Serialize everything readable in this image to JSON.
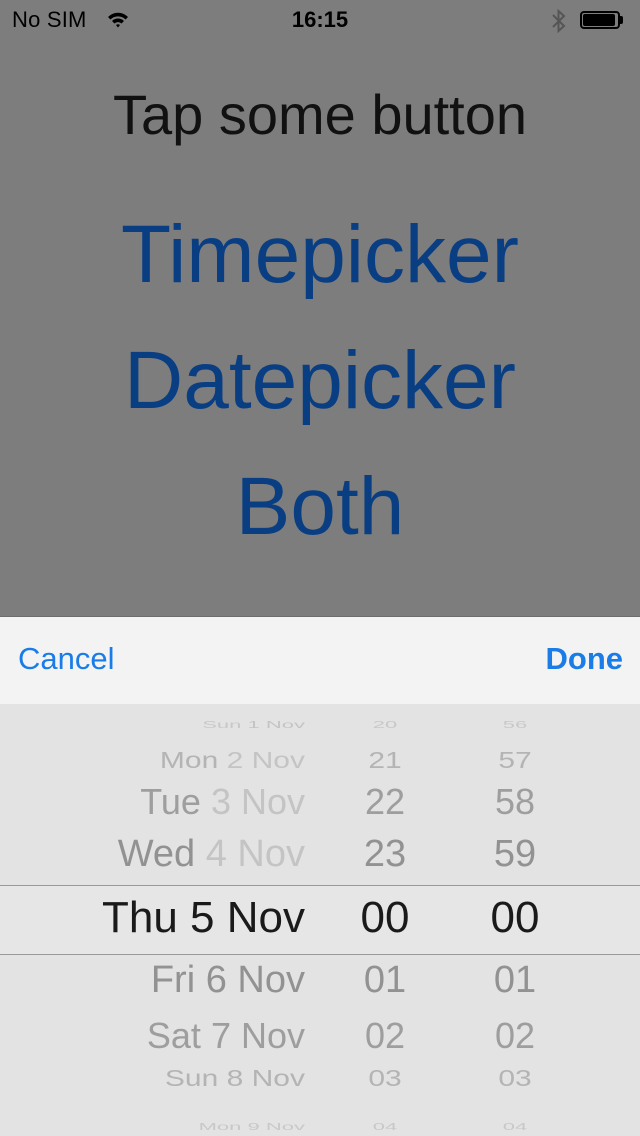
{
  "status_bar": {
    "carrier": "No SIM",
    "time": "16:15",
    "battery_level": 1.0,
    "icons": [
      "wifi-icon",
      "bluetooth-icon",
      "battery-icon"
    ]
  },
  "main": {
    "headline": "Tap some button",
    "buttons": {
      "timepicker": "Timepicker",
      "datepicker": "Datepicker",
      "both": "Both"
    }
  },
  "toolbar": {
    "cancel_label": "Cancel",
    "done_label": "Done"
  },
  "picker": {
    "rows": [
      {
        "weekday": "Sun",
        "daymonth": "1 Nov",
        "hour": "20",
        "minute": "56"
      },
      {
        "weekday": "Mon",
        "daymonth": "2 Nov",
        "hour": "21",
        "minute": "57"
      },
      {
        "weekday": "Tue",
        "daymonth": "3 Nov",
        "hour": "22",
        "minute": "58"
      },
      {
        "weekday": "Wed",
        "daymonth": "4 Nov",
        "hour": "23",
        "minute": "59"
      },
      {
        "weekday": "Thu",
        "daymonth": "5 Nov",
        "hour": "00",
        "minute": "00"
      },
      {
        "weekday": "Fri",
        "daymonth": "6 Nov",
        "hour": "01",
        "minute": "01"
      },
      {
        "weekday": "Sat",
        "daymonth": "7 Nov",
        "hour": "02",
        "minute": "02"
      },
      {
        "weekday": "Sun",
        "daymonth": "8 Nov",
        "hour": "03",
        "minute": "03"
      },
      {
        "weekday": "Mon",
        "daymonth": "9 Nov",
        "hour": "04",
        "minute": "04"
      }
    ],
    "selected_index": 4,
    "colors": {
      "accent": "#1a7ce6",
      "button_text": "#0a3e83"
    }
  }
}
